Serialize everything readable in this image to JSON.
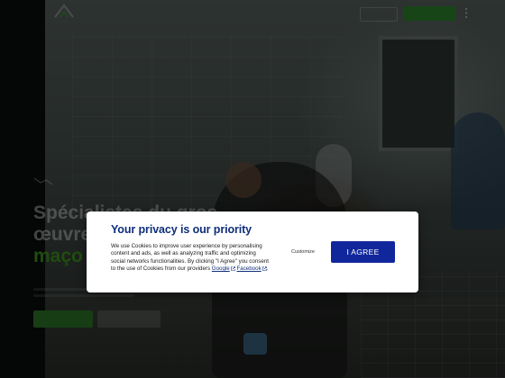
{
  "nav": {
    "top_link_label": "",
    "cta_label": "",
    "icon_logo": "logo-icon",
    "icon_menu": "menu-icon"
  },
  "hero": {
    "title_lines": [
      "Spécialistes du gros",
      "œuvre"
    ],
    "title_accent": "maço",
    "accent_color": "#3f9a1f"
  },
  "consent": {
    "title": "Your privacy is our priority",
    "body_prefix": "We use Cookies to improve user experience by personalising content and ads, as well as analyzing traffic and optimizing social networks functionalities. By clicking \"I Agree\" you consent to the use of Cookies from our providers",
    "link_google": "Google",
    "link_facebook": "Facebook",
    "body_suffix": ".",
    "customize_label": "Customize",
    "agree_label": "I AGREE",
    "title_color": "#0f2f7a",
    "agree_color": "#10279b"
  }
}
